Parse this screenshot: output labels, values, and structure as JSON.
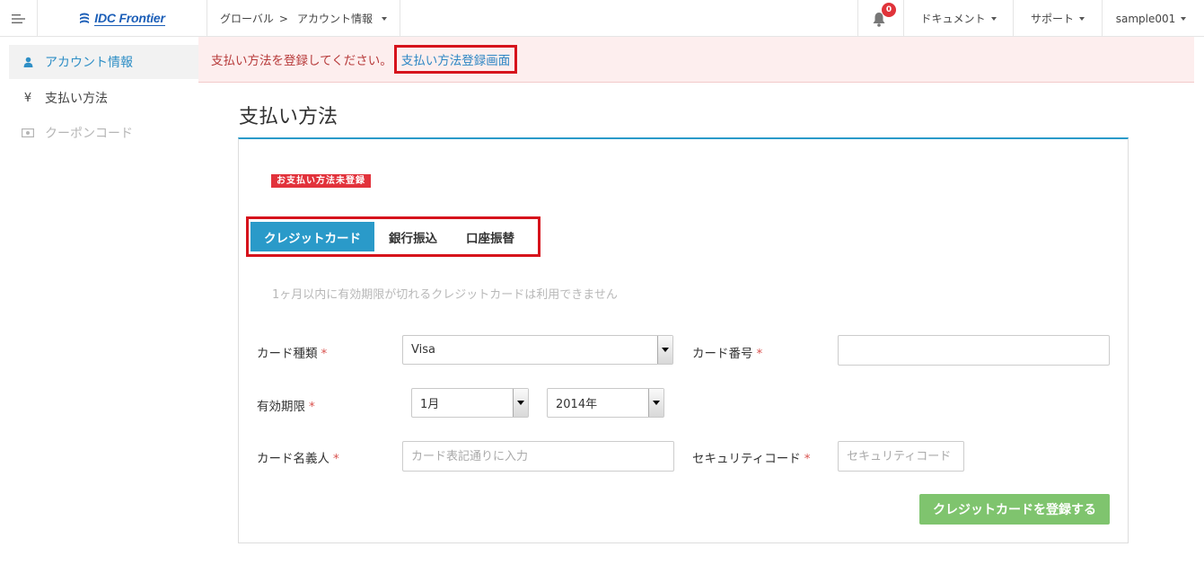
{
  "header": {
    "brand": "IDC Frontier",
    "breadcrumb_root": "グローバル",
    "breadcrumb_sep": ">",
    "breadcrumb_current": "アカウント情報",
    "notification_count": "0",
    "nav_docs": "ドキュメント",
    "nav_support": "サポート",
    "user": "sample001"
  },
  "sidebar": {
    "items": [
      {
        "label": "アカウント情報",
        "icon": "user-icon",
        "state": "active"
      },
      {
        "label": "支払い方法",
        "icon": "yen-icon",
        "state": "normal"
      },
      {
        "label": "クーポンコード",
        "icon": "coupon-icon",
        "state": "disabled"
      }
    ]
  },
  "alert": {
    "message": "支払い方法を登録してください。",
    "link": "支払い方法登録画面"
  },
  "main": {
    "title": "支払い方法",
    "status_tag": "お支払い方法未登録",
    "tabs": [
      "クレジットカード",
      "銀行振込",
      "口座振替"
    ],
    "active_tab": "クレジットカード",
    "note": "1ヶ月以内に有効期限が切れるクレジットカードは利用できません"
  },
  "form": {
    "card_type_label": "カード種類",
    "card_type_value": "Visa",
    "card_number_label": "カード番号",
    "card_number_value": "",
    "expiry_label": "有効期限",
    "expiry_month": "1月",
    "expiry_year": "2014年",
    "holder_label": "カード名義人",
    "holder_placeholder": "カード表記通りに入力",
    "security_label": "セキュリティコード",
    "security_placeholder": "セキュリティコード",
    "required_mark": "*",
    "submit": "クレジットカードを登録する"
  },
  "colors": {
    "accent": "#2a9ac9",
    "alert_bg": "#fdeeee",
    "alert_text": "#b73a3a",
    "highlight": "#d6131c",
    "submit": "#7fc46e",
    "badge": "#e0333a"
  }
}
